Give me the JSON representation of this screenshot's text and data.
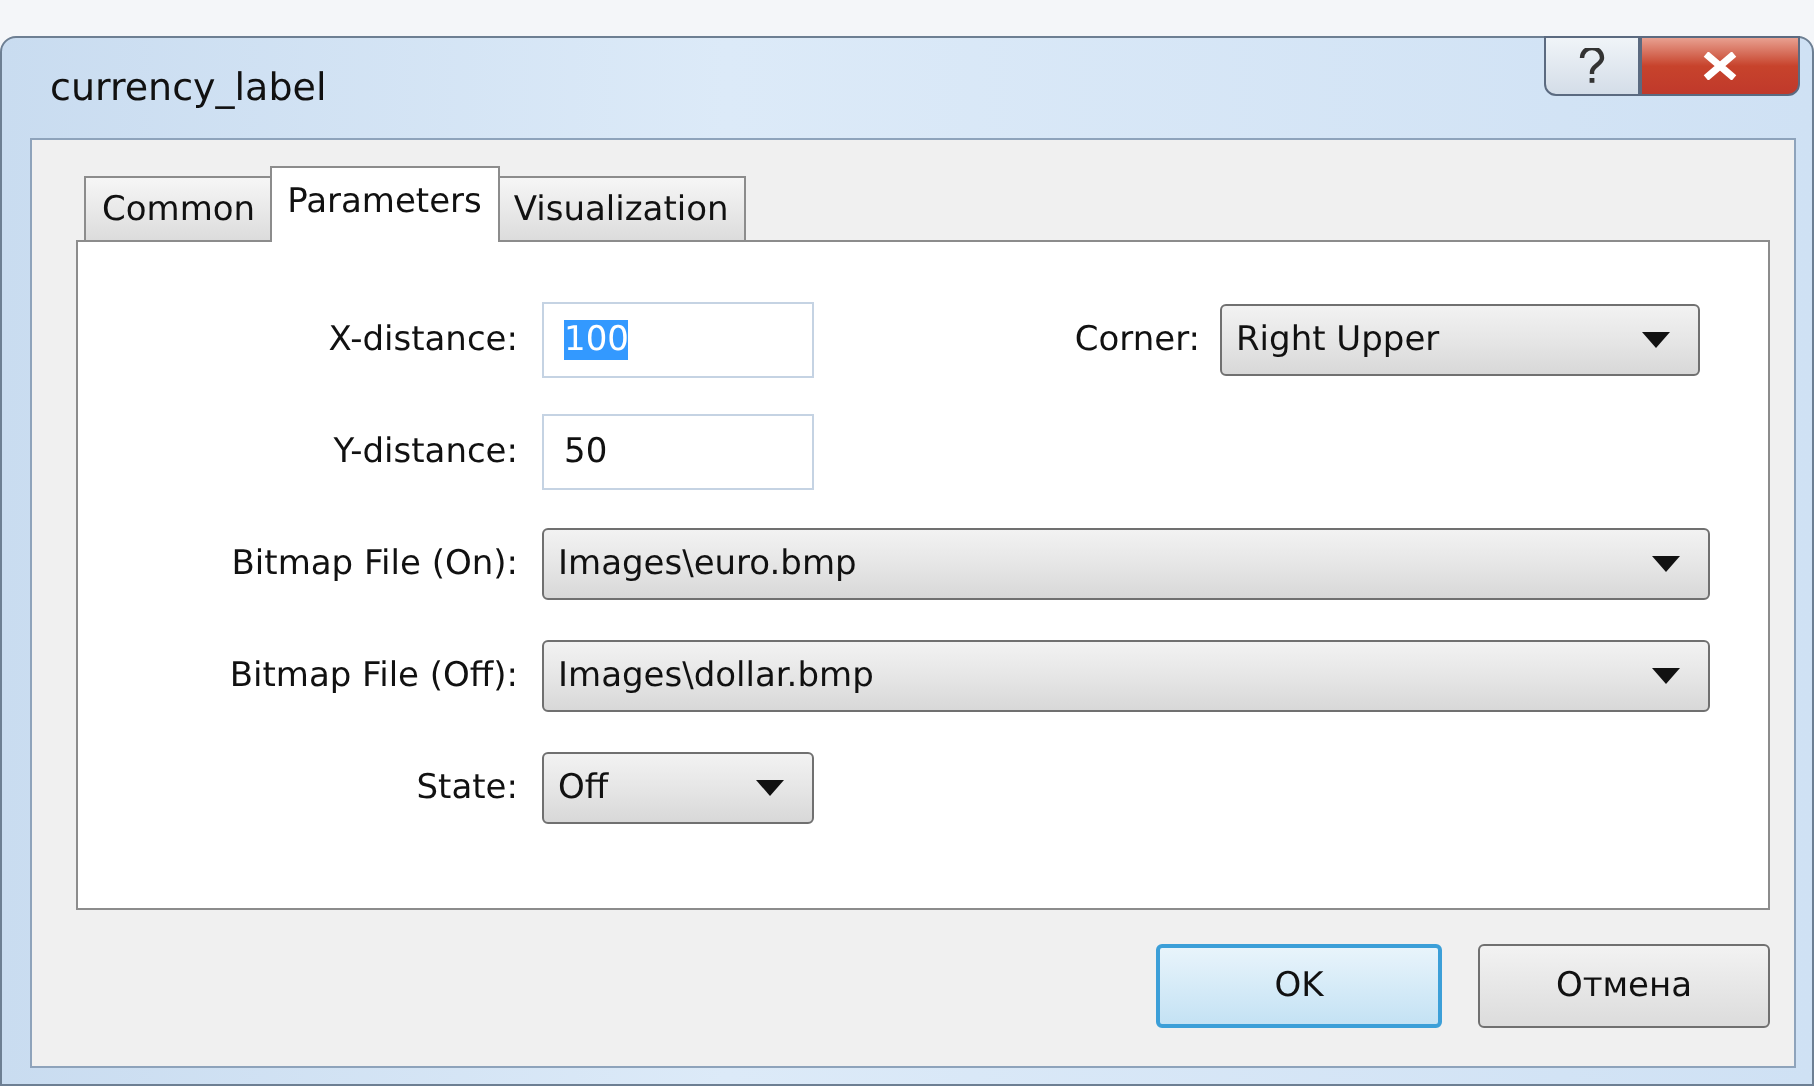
{
  "window": {
    "title": "currency_label"
  },
  "tabs": [
    {
      "label": "Common",
      "selected": false
    },
    {
      "label": "Parameters",
      "selected": true
    },
    {
      "label": "Visualization",
      "selected": false
    }
  ],
  "rows": [
    {
      "fields": [
        {
          "kind": "text",
          "label": "X-distance:",
          "value": "100",
          "highlighted": true
        },
        {
          "kind": "dropdown",
          "label": "Corner:",
          "value": "Right Upper"
        }
      ]
    },
    {
      "fields": [
        {
          "kind": "text",
          "label": "Y-distance:",
          "value": "50",
          "highlighted": false
        }
      ]
    },
    {
      "fields": [
        {
          "kind": "dropdown",
          "label": "Bitmap File (On):",
          "value": "Images\\euro.bmp"
        }
      ]
    },
    {
      "fields": [
        {
          "kind": "dropdown",
          "label": "Bitmap File (Off):",
          "value": "Images\\dollar.bmp"
        }
      ]
    },
    {
      "fields": [
        {
          "kind": "short_dropdown",
          "label": "State:",
          "value": "Off"
        }
      ]
    }
  ],
  "buttons": [
    {
      "label": "OK",
      "default": true
    },
    {
      "label": "Отмена",
      "default": false
    }
  ]
}
